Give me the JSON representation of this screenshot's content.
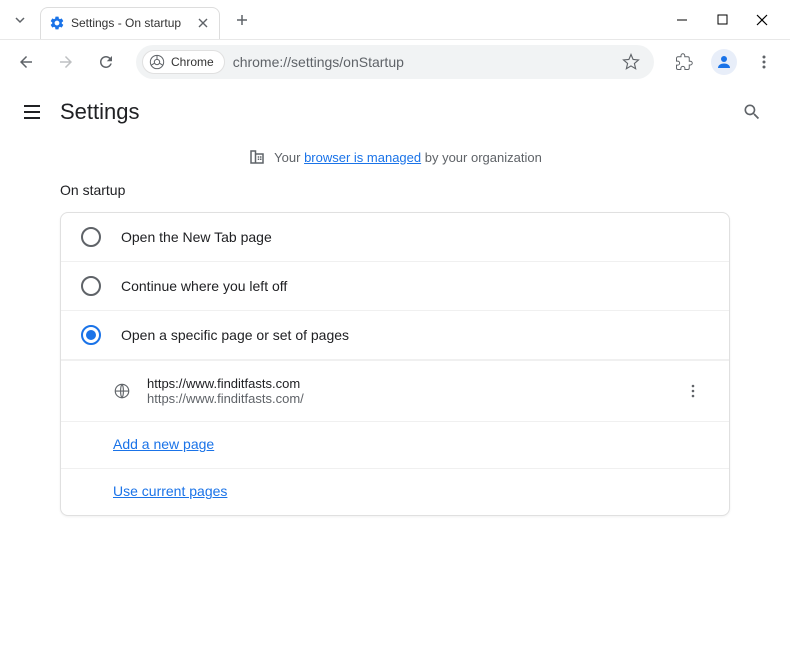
{
  "window": {
    "tab_title": "Settings - On startup"
  },
  "toolbar": {
    "chrome_chip": "Chrome",
    "url": "chrome://settings/onStartup"
  },
  "header": {
    "title": "Settings"
  },
  "managed": {
    "prefix": "Your ",
    "link": "browser is managed",
    "suffix": " by your organization"
  },
  "section": {
    "title": "On startup"
  },
  "options": {
    "new_tab": "Open the New Tab page",
    "continue": "Continue where you left off",
    "specific": "Open a specific page or set of pages"
  },
  "startup_page": {
    "title": "https://www.finditfasts.com",
    "url": "https://www.finditfasts.com/"
  },
  "actions": {
    "add_page": "Add a new page",
    "use_current": "Use current pages"
  }
}
